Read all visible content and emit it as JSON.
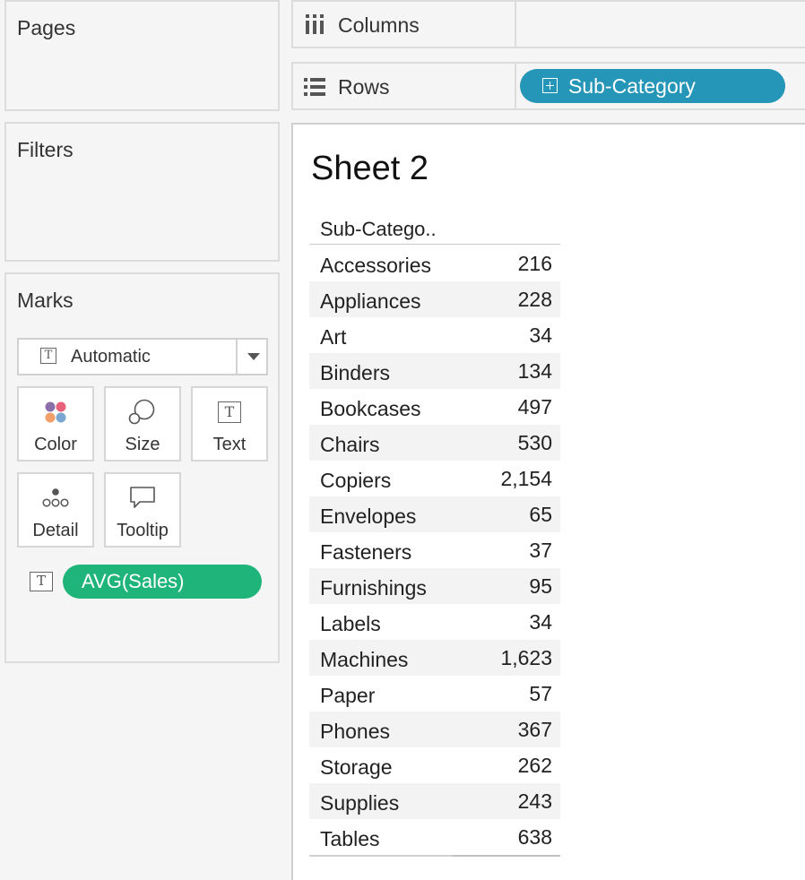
{
  "panels": {
    "pages": "Pages",
    "filters": "Filters",
    "marks": "Marks"
  },
  "marks": {
    "type_dropdown": "Automatic",
    "buttons": {
      "color": "Color",
      "size": "Size",
      "text": "Text",
      "detail": "Detail",
      "tooltip": "Tooltip"
    },
    "text_pill": "AVG(Sales)"
  },
  "shelves": {
    "columns": "Columns",
    "rows": "Rows",
    "rows_pill": "Sub-Category"
  },
  "sheet": {
    "title": "Sheet 2",
    "column_header": "Sub-Catego..",
    "rows": [
      {
        "category": "Accessories",
        "value": "216"
      },
      {
        "category": "Appliances",
        "value": "228"
      },
      {
        "category": "Art",
        "value": "34"
      },
      {
        "category": "Binders",
        "value": "134"
      },
      {
        "category": "Bookcases",
        "value": "497"
      },
      {
        "category": "Chairs",
        "value": "530"
      },
      {
        "category": "Copiers",
        "value": "2,154"
      },
      {
        "category": "Envelopes",
        "value": "65"
      },
      {
        "category": "Fasteners",
        "value": "37"
      },
      {
        "category": "Furnishings",
        "value": "95"
      },
      {
        "category": "Labels",
        "value": "34"
      },
      {
        "category": "Machines",
        "value": "1,623"
      },
      {
        "category": "Paper",
        "value": "57"
      },
      {
        "category": "Phones",
        "value": "367"
      },
      {
        "category": "Storage",
        "value": "262"
      },
      {
        "category": "Supplies",
        "value": "243"
      },
      {
        "category": "Tables",
        "value": "638"
      }
    ]
  },
  "colors": {
    "rows_pill": "#2696b8",
    "measure_pill": "#1fb57a",
    "color_dots": [
      "#8b6fa8",
      "#e9607a",
      "#f2a06a",
      "#7aa6cf"
    ]
  }
}
